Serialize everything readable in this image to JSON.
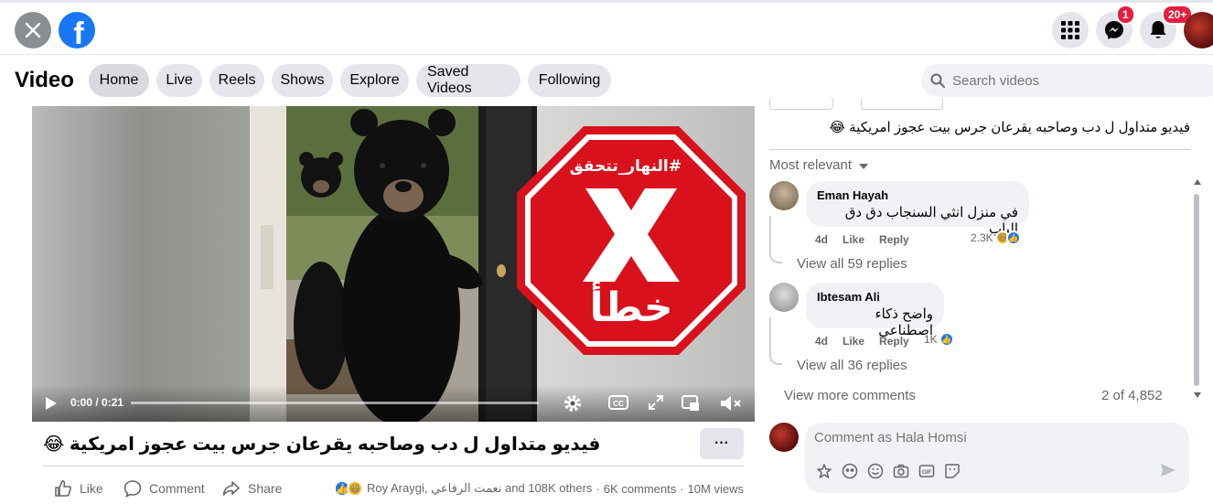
{
  "topbar": {
    "messenger_badge": "1",
    "notifications_badge": "20+"
  },
  "videobar": {
    "title": "Video",
    "tabs": [
      "Home",
      "Live",
      "Reels",
      "Shows",
      "Explore",
      "Saved Videos",
      "Following"
    ],
    "search_placeholder": "Search videos"
  },
  "player": {
    "overlay_hashtag": "#النهار_تتحقق",
    "overlay_verdict": "خطأ",
    "time": "0:00 / 0:21"
  },
  "post": {
    "title": "فيديو متداول ل دب وصاحبه يقرعان جرس بيت عجوز امريكية 😂",
    "more": "···",
    "like_label": "Like",
    "comment_label": "Comment",
    "share_label": "Share",
    "reactions_text": "Roy Araygi, نعمت الرفاعي and 108K others",
    "comments_count": "6K comments",
    "views_count": "10M views"
  },
  "side": {
    "header_text": "فيديو متداول ل دب وصاحبه يقرعان جرس بيت عجوز امريكية 😂",
    "sort_label": "Most relevant",
    "comments": [
      {
        "name": "Eman Hayah",
        "text": "في منزل انثي السنجاب دق دق الباب",
        "age": "4d",
        "like": "Like",
        "reply": "Reply",
        "reactions": "2.3K",
        "view_replies": "View all 59 replies"
      },
      {
        "name": "Ibtesam Ali",
        "text": "واضح ذكاء اصطناعي",
        "age": "4d",
        "like": "Like",
        "reply": "Reply",
        "reactions": "1K",
        "view_replies": "View all 36 replies"
      }
    ],
    "view_more": "View more comments",
    "count": "2 of 4,852",
    "composer_placeholder": "Comment as Hala Homsi"
  },
  "colors": {
    "facebook_blue": "#1877f2",
    "badge_red": "#e41e3f",
    "stop_sign_red": "#d9111c"
  }
}
